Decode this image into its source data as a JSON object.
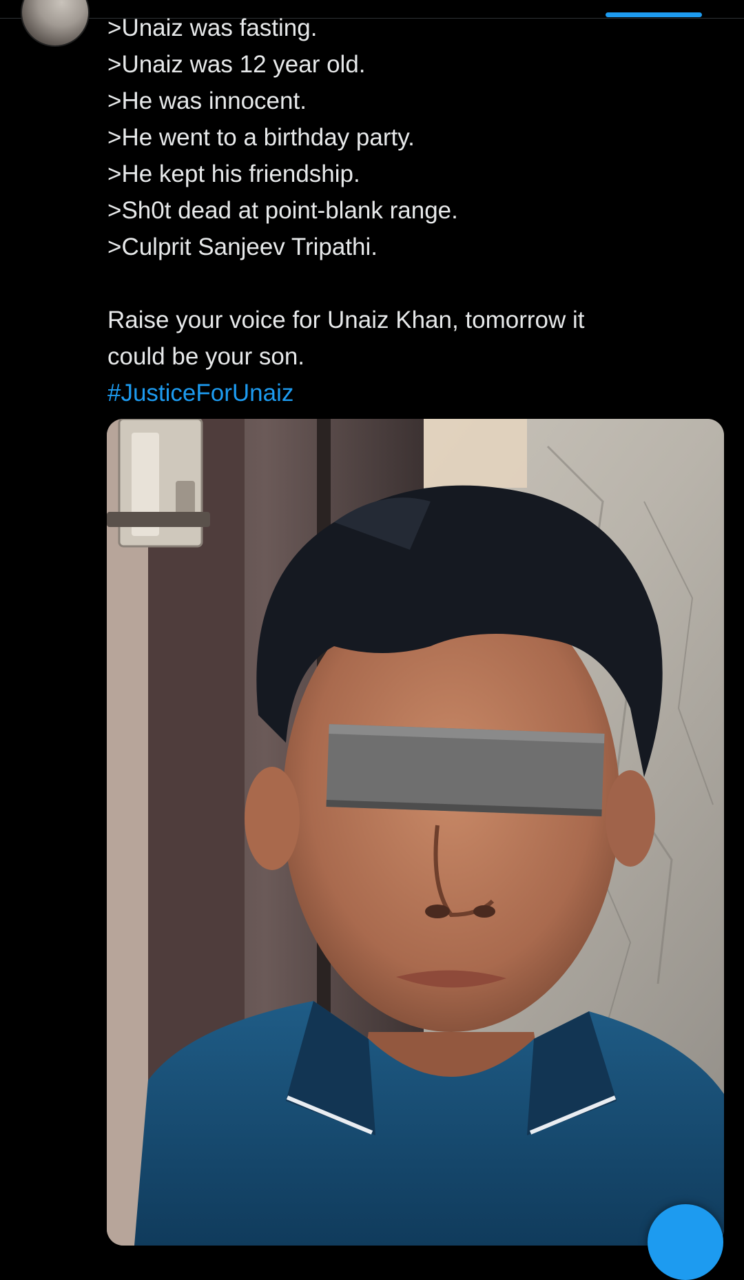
{
  "colors": {
    "accent": "#1d9bf0",
    "background": "#000000",
    "text": "#e7e9ea"
  },
  "tweet": {
    "lines": [
      ">Unaiz was fasting.",
      ">Unaiz was 12 year old.",
      ">He was innocent.",
      ">He went to a birthday party.",
      ">He kept his friendship.",
      ">Sh0t dead at point-blank range.",
      ">Culprit Sanjeev Tripathi."
    ],
    "closing_line_1": "Raise your voice for Unaiz Khan, tomorrow it",
    "closing_line_2": "could be your son.",
    "hashtag": "#JusticeForUnaiz"
  },
  "icons": {
    "fab": "compose-icon"
  }
}
